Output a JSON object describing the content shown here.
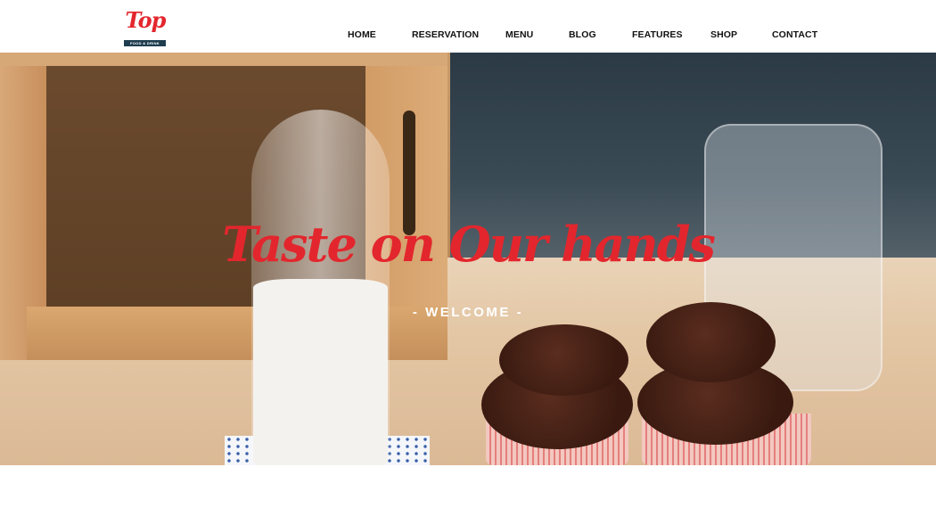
{
  "brand": {
    "logo_text": "Top",
    "logo_tagline": "FOOD & DRINK"
  },
  "nav": {
    "items": [
      {
        "label": "HOME"
      },
      {
        "label": "RESERVATION"
      },
      {
        "label": "MENU"
      },
      {
        "label": "BLOG"
      },
      {
        "label": "FEATURES"
      },
      {
        "label": "SHOP"
      },
      {
        "label": "CONTACT"
      }
    ]
  },
  "hero": {
    "title": "Taste on Our hands",
    "subtitle": "- WELCOME -"
  },
  "colors": {
    "accent": "#e3262d",
    "logo_bar": "#1f3d4f",
    "nav_text": "#111111",
    "welcome_text": "#ffffff"
  }
}
